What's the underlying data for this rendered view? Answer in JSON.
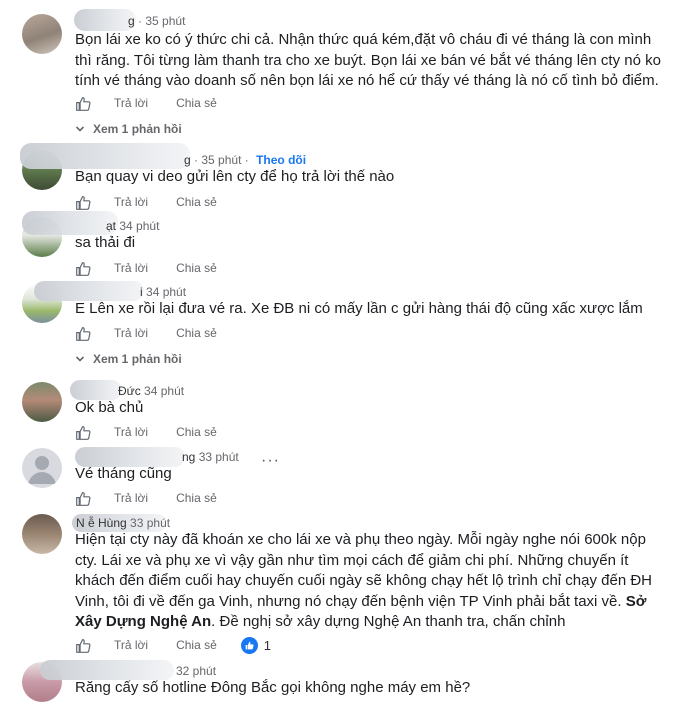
{
  "comments": [
    {
      "name_visible": "g",
      "time": "35 phút",
      "follow": "",
      "text": "Bọn lái xe ko có ý thức chi cả. Nhận thức quá kém,đặt vô cháu đi vé tháng là con mình thì răng. Tôi từng làm thanh tra cho xe buýt. Bọn lái xe bán vé bắt vé tháng lên cty nó ko tính vé tháng vào doanh số nên bọn lái xe nó hể cứ thấy vé tháng là nó cố tình bỏ điểm.",
      "reply": "Trả lời",
      "share": "Chia sẻ",
      "view_replies": "Xem 1 phản hồi"
    },
    {
      "name_visible": "g",
      "time": "35 phút",
      "follow": "Theo dõi",
      "text": "Bạn quay vi deo gửi lên cty để họ trả lời thế nào",
      "reply": "Trả lời",
      "share": "Chia sẻ"
    },
    {
      "name_visible": "ạt",
      "time": "34 phút",
      "follow": "",
      "text": "sa thải đi",
      "reply": "Trả lời",
      "share": "Chia sẻ"
    },
    {
      "name_visible": "i",
      "time": "34 phút",
      "follow": "",
      "text": "E Lên xe rồi lại đưa vé ra. Xe ĐB ni có mấy lần c gửi hàng thái độ cũng xấc xược lắm",
      "reply": "Trả lời",
      "share": "Chia sẻ",
      "view_replies": "Xem 1 phản hồi"
    },
    {
      "name_visible": "Đức",
      "time": "34 phút",
      "follow": "",
      "text": "Ok bà chủ",
      "reply": "Trả lời",
      "share": "Chia sẻ"
    },
    {
      "name_visible": "ng",
      "time": "33 phút",
      "follow": "",
      "more": "···",
      "text": "Vé tháng cũng",
      "reply": "Trả lời",
      "share": "Chia sẻ"
    },
    {
      "name_visible": "N   ễ  Hùng",
      "time": "33 phút",
      "follow": "",
      "text_before": "Hiện tại cty này đã khoán xe cho lái xe và phụ theo ngày. Mỗi ngày nghe nói 600k nộp cty. Lái xe và phụ xe vì vậy gần như tìm mọi cách để giảm chi phí. Những chuyến ít khách đến điểm cuối hay chuyến cuối ngày sẽ không chạy hết lộ trình chỉ chạy đến ĐH Vinh, tôi đi về đến ga Vinh, nhưng nó chạy đến bệnh viện TP Vinh phải bắt taxi về. ",
      "text_bold": "Sở Xây Dựng Nghệ An",
      "text_after": ". Đề nghị sở xây dựng Nghệ An thanh tra, chấn chỉnh",
      "reply": "Trả lời",
      "share": "Chia sẻ",
      "reaction_count": "1"
    },
    {
      "name_visible": "",
      "time": "32 phút",
      "follow": "",
      "text": "Răng cấy số hotline Đông Bắc gọi không nghe máy em hề?"
    }
  ],
  "colors": {
    "meta": "#65676b",
    "link": "#1877f2",
    "text": "#1c1e21"
  },
  "icons": {
    "like": "thumbs-up-outline-icon",
    "reaction": "like-reaction-icon",
    "expand": "chevron-down-icon",
    "more": "more-options-icon"
  }
}
